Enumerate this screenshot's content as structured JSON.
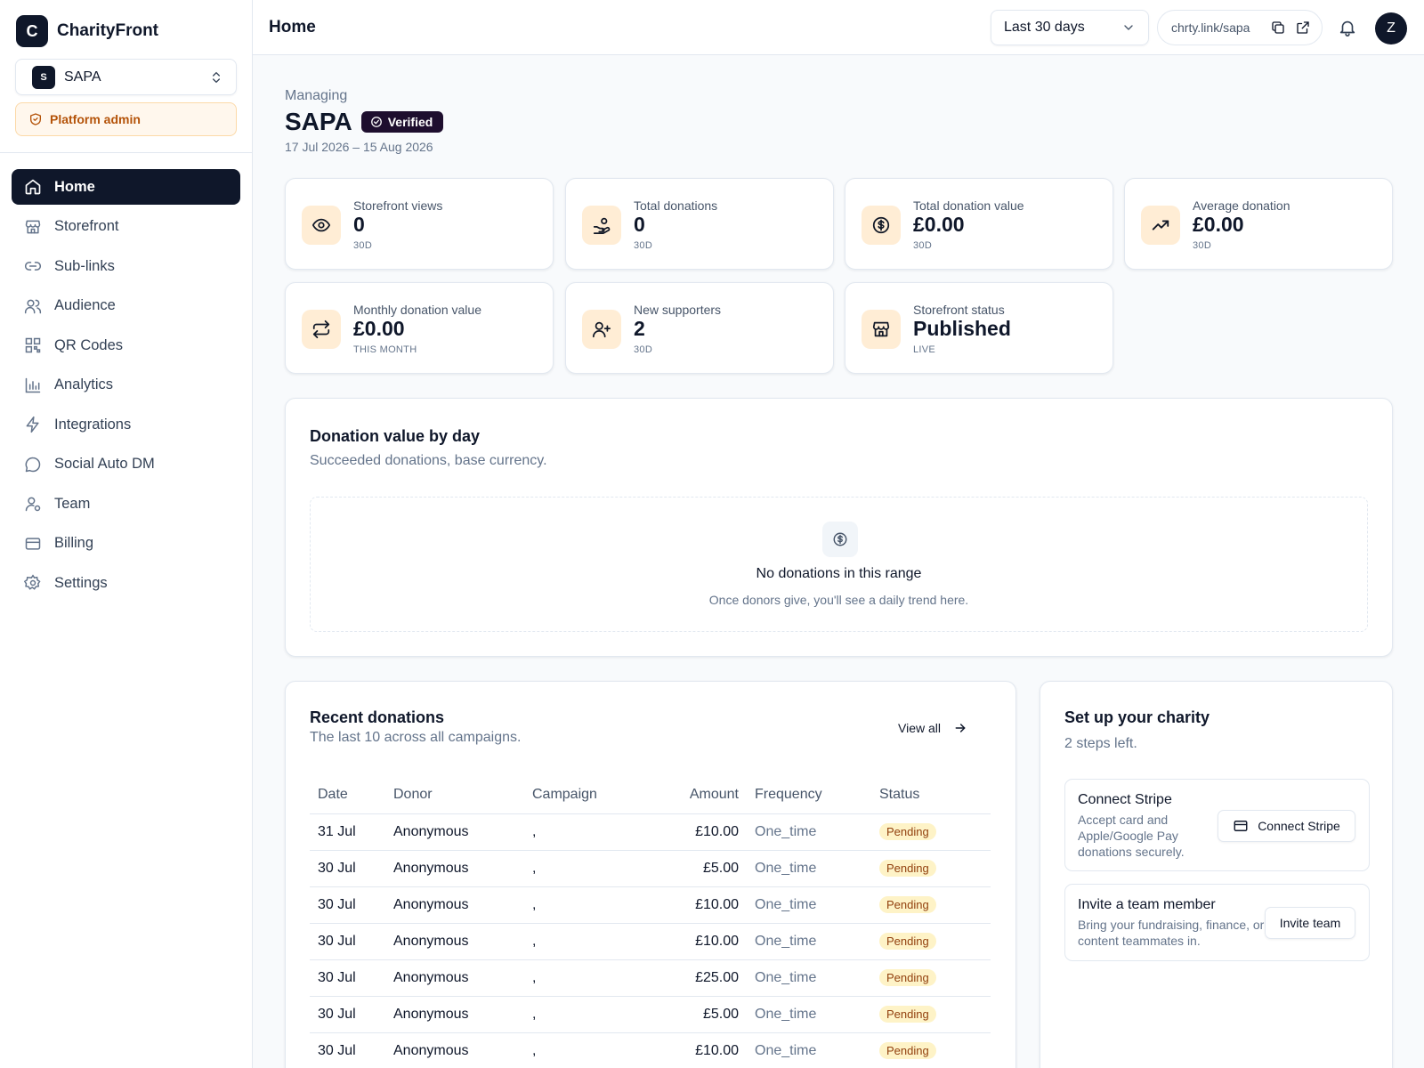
{
  "brand": {
    "logo_letter": "C",
    "name": "CharityFront"
  },
  "org_switcher": {
    "avatar_letter": "S",
    "name": "SAPA"
  },
  "admin_badge": "Platform admin",
  "nav": [
    {
      "label": "Home",
      "icon": "home-icon",
      "active": true
    },
    {
      "label": "Storefront",
      "icon": "store-icon"
    },
    {
      "label": "Sub-links",
      "icon": "link-icon"
    },
    {
      "label": "Audience",
      "icon": "users-icon"
    },
    {
      "label": "QR Codes",
      "icon": "qr-icon"
    },
    {
      "label": "Analytics",
      "icon": "bar-chart-icon"
    },
    {
      "label": "Integrations",
      "icon": "bolt-icon"
    },
    {
      "label": "Social Auto DM",
      "icon": "message-icon"
    },
    {
      "label": "Team",
      "icon": "user-cog-icon"
    },
    {
      "label": "Billing",
      "icon": "credit-card-icon"
    },
    {
      "label": "Settings",
      "icon": "gear-icon"
    }
  ],
  "header": {
    "title": "Home",
    "range": "Last 30 days",
    "short_link": "chrty.link/sapa",
    "avatar_letter": "Z"
  },
  "overview": {
    "managing_label": "Managing",
    "org_name": "SAPA",
    "verified_label": "Verified",
    "date_range": "17 Jul 2026 – 15 Aug 2026"
  },
  "stats": [
    {
      "label": "Storefront views",
      "value": "0",
      "sub": "30D",
      "icon": "eye-icon"
    },
    {
      "label": "Total donations",
      "value": "0",
      "sub": "30D",
      "icon": "hand-coins-icon"
    },
    {
      "label": "Total donation value",
      "value": "£0.00",
      "sub": "30D",
      "icon": "dollar-circle-icon"
    },
    {
      "label": "Average donation",
      "value": "£0.00",
      "sub": "30D",
      "icon": "trending-up-icon"
    },
    {
      "label": "Monthly donation value",
      "value": "£0.00",
      "sub": "THIS MONTH",
      "icon": "repeat-icon"
    },
    {
      "label": "New supporters",
      "value": "2",
      "sub": "30D",
      "icon": "user-plus-icon"
    },
    {
      "label": "Storefront status",
      "value": "Published",
      "sub": "LIVE",
      "icon": "store-icon"
    }
  ],
  "chart_section": {
    "title": "Donation value by day",
    "subtitle": "Succeeded donations, base currency.",
    "empty_title": "No donations in this range",
    "empty_subtitle": "Once donors give, you'll see a daily trend here."
  },
  "recent": {
    "title": "Recent donations",
    "subtitle": "The last 10 across all campaigns.",
    "view_all": "View all",
    "columns": [
      "Date",
      "Donor",
      "Campaign",
      "Amount",
      "Frequency",
      "Status"
    ],
    "rows": [
      {
        "date": "31 Jul",
        "donor": "Anonymous",
        "campaign": ",",
        "amount": "£10.00",
        "frequency": "One_time",
        "status": "Pending"
      },
      {
        "date": "30 Jul",
        "donor": "Anonymous",
        "campaign": ",",
        "amount": "£5.00",
        "frequency": "One_time",
        "status": "Pending"
      },
      {
        "date": "30 Jul",
        "donor": "Anonymous",
        "campaign": ",",
        "amount": "£10.00",
        "frequency": "One_time",
        "status": "Pending"
      },
      {
        "date": "30 Jul",
        "donor": "Anonymous",
        "campaign": ",",
        "amount": "£10.00",
        "frequency": "One_time",
        "status": "Pending"
      },
      {
        "date": "30 Jul",
        "donor": "Anonymous",
        "campaign": ",",
        "amount": "£25.00",
        "frequency": "One_time",
        "status": "Pending"
      },
      {
        "date": "30 Jul",
        "donor": "Anonymous",
        "campaign": ",",
        "amount": "£5.00",
        "frequency": "One_time",
        "status": "Pending"
      },
      {
        "date": "30 Jul",
        "donor": "Anonymous",
        "campaign": ",",
        "amount": "£10.00",
        "frequency": "One_time",
        "status": "Pending"
      }
    ]
  },
  "setup": {
    "title": "Set up your charity",
    "subtitle": "2 steps left.",
    "steps": [
      {
        "title": "Connect Stripe",
        "description": "Accept card and Apple/Google Pay donations securely.",
        "button": "Connect Stripe"
      },
      {
        "title": "Invite a team member",
        "description": "Bring your fundraising, finance, or content teammates in.",
        "button": "Invite team"
      }
    ]
  }
}
